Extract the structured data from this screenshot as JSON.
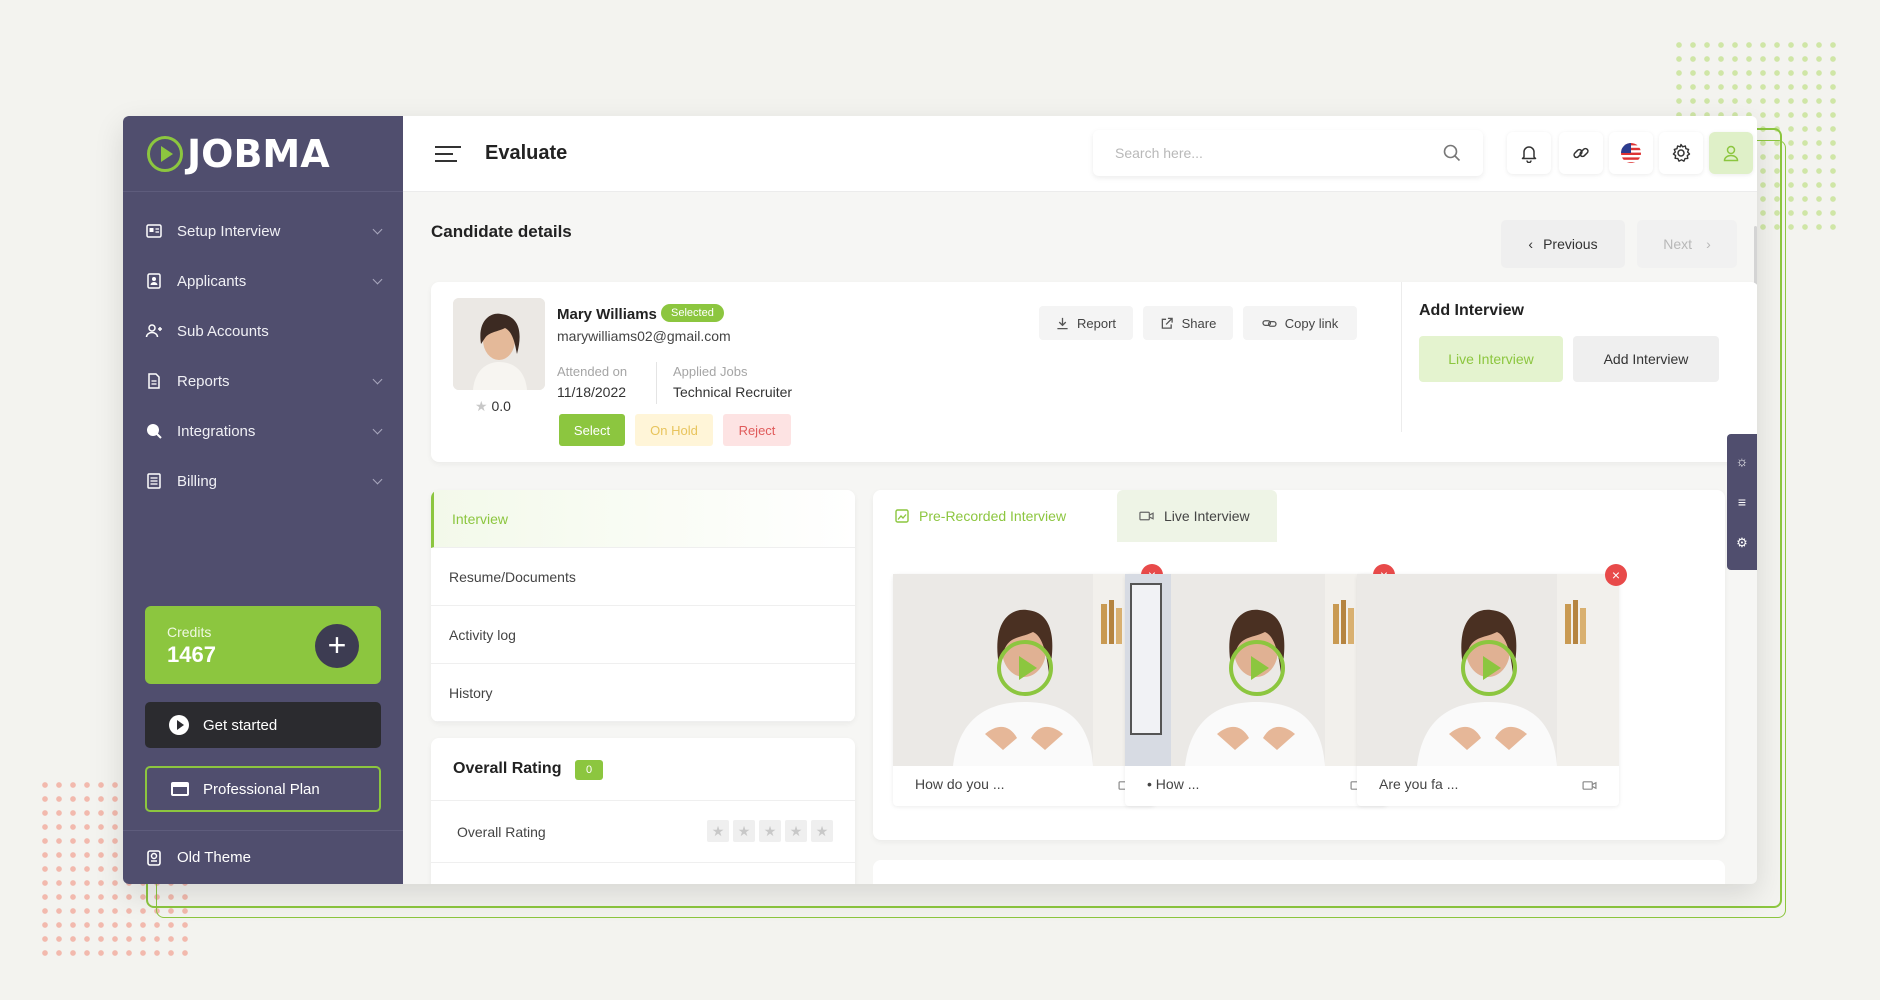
{
  "app": {
    "logo_text": "JOBMA",
    "page_title": "Evaluate"
  },
  "colors": {
    "brand": "#8cc63f",
    "sidebar": "#504e6e",
    "danger": "#e84a4a",
    "hold": "#e8c45c"
  },
  "search": {
    "placeholder": "Search here..."
  },
  "topbar": {
    "icons": [
      "bell-icon",
      "link-icon",
      "us-flag-icon",
      "gear-icon",
      "user-icon"
    ]
  },
  "sidebar": {
    "items": [
      {
        "label": "Setup Interview",
        "icon": "setup-icon",
        "has_submenu": true
      },
      {
        "label": "Applicants",
        "icon": "applicants-icon",
        "has_submenu": true
      },
      {
        "label": "Sub Accounts",
        "icon": "sub-accounts-icon",
        "has_submenu": false
      },
      {
        "label": "Reports",
        "icon": "reports-icon",
        "has_submenu": true
      },
      {
        "label": "Integrations",
        "icon": "integrations-icon",
        "has_submenu": true
      },
      {
        "label": "Billing",
        "icon": "billing-icon",
        "has_submenu": true
      }
    ],
    "credits_label": "Credits",
    "credits_value": "1467",
    "get_started": "Get started",
    "plan": "Professional Plan",
    "old_theme": "Old Theme"
  },
  "candidate": {
    "section_title": "Candidate details",
    "previous": "Previous",
    "next": "Next",
    "name": "Mary Williams",
    "status": "Selected",
    "email": "marywilliams02@gmail.com",
    "rating": "0.0",
    "attended_label": "Attended on",
    "attended_value": "11/18/2022",
    "applied_label": "Applied Jobs",
    "applied_value": "Technical Recruiter",
    "actions": {
      "select": "Select",
      "hold": "On Hold",
      "reject": "Reject"
    },
    "toolbar": {
      "report": "Report",
      "share": "Share",
      "copy": "Copy link"
    }
  },
  "add_interview": {
    "title": "Add Interview",
    "live": "Live Interview",
    "add": "Add Interview"
  },
  "left_menu": {
    "items": [
      "Interview",
      "Resume/Documents",
      "Activity log",
      "History"
    ],
    "active": 0
  },
  "overall_rating": {
    "title": "Overall Rating",
    "badge": "0",
    "row_label": "Overall Rating",
    "stars": 0,
    "max_stars": 5
  },
  "video_panel": {
    "tabs": [
      "Pre-Recorded Interview",
      "Live Interview"
    ],
    "active_tab": 0,
    "videos": [
      {
        "caption": "How do you ..."
      },
      {
        "caption": "• How ..."
      },
      {
        "caption": "Are you fa ..."
      }
    ]
  }
}
